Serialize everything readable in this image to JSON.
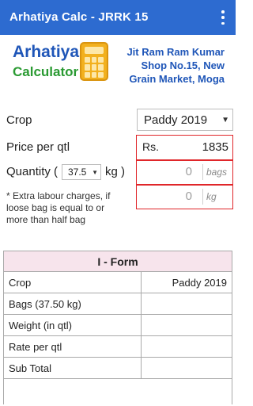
{
  "app_bar": {
    "title": "Arhatiya Calc - JRRK 15",
    "menu_icon": "more-vert-icon"
  },
  "header": {
    "logo_line1": "Arhatiya",
    "logo_line2": "Calculator",
    "logo_icon": "calculator-icon",
    "shop_lines": [
      "Jit Ram Ram Kumar",
      "Shop No.15, New",
      "Grain Market, Moga"
    ],
    "colors": {
      "logo_blue": "#1f56b8",
      "logo_green": "#2a9a32",
      "icon_orange": "#f2b01e"
    }
  },
  "form": {
    "crop_label": "Crop",
    "crop_selected": "Paddy 2019",
    "price_label": "Price per qtl",
    "price_prefix": "Rs.",
    "price_value": "1835",
    "quantity_label_prefix": "Quantity (",
    "quantity_selected": "37.5",
    "quantity_label_suffix": "kg )",
    "bags_value": "0",
    "bags_unit": "bags",
    "kg_value": "0",
    "kg_unit": "kg",
    "note": "* Extra labour charges, if loose bag is equal to or more than half bag",
    "highlight_color": "#e0262a"
  },
  "iform": {
    "title": "I - Form",
    "rows": [
      {
        "label": "Crop",
        "value": "Paddy 2019"
      },
      {
        "label": "Bags (37.50 kg)",
        "value": ""
      },
      {
        "label": "Weight (in qtl)",
        "value": ""
      },
      {
        "label": "Rate per qtl",
        "value": ""
      },
      {
        "label": "Sub Total",
        "value": ""
      }
    ],
    "header_bg": "#f7e4ec"
  }
}
